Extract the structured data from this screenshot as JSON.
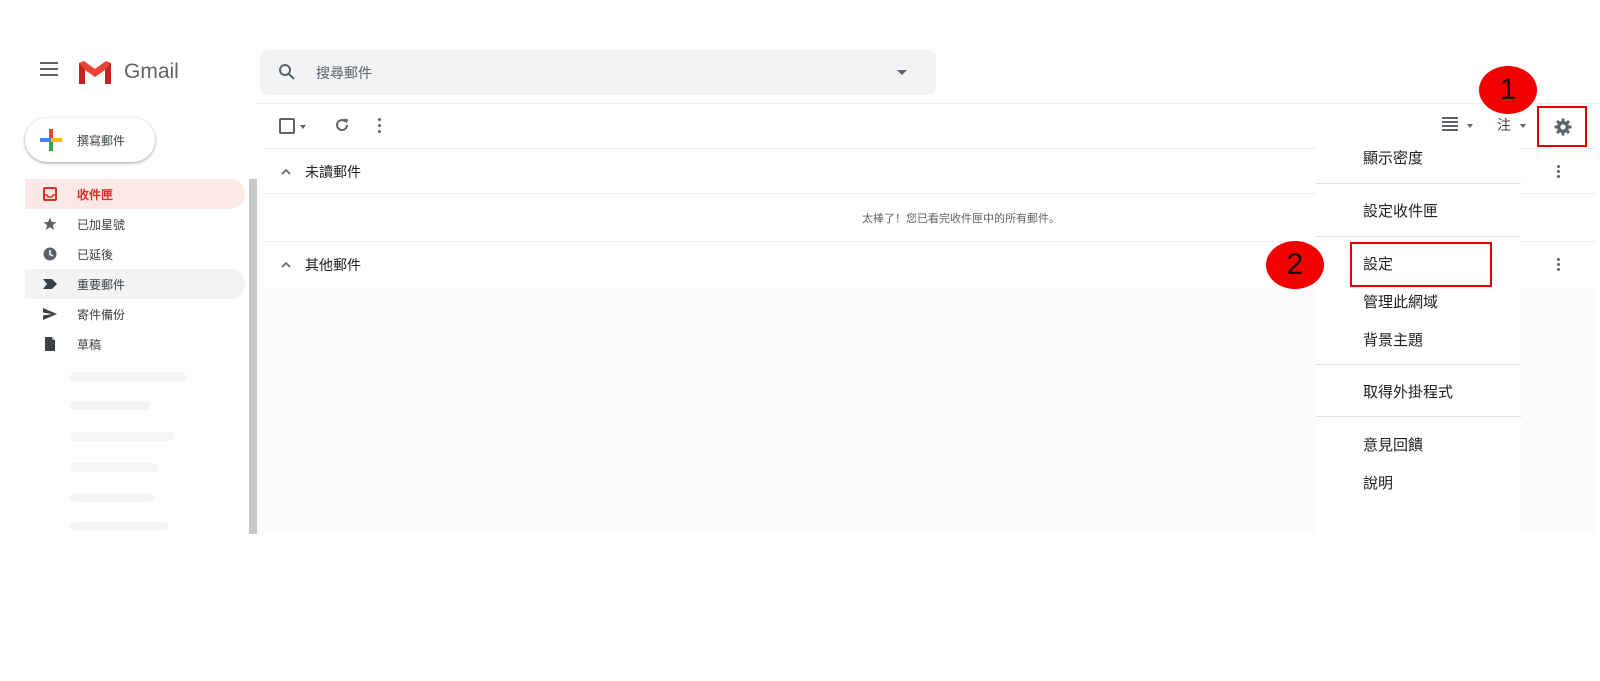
{
  "header": {
    "brand": "Gmail",
    "search": {
      "placeholder": "搜尋郵件"
    }
  },
  "sidebar": {
    "compose_label": "撰寫郵件",
    "items": [
      {
        "label": "收件匣",
        "icon": "inbox-icon",
        "state": "active"
      },
      {
        "label": "已加星號",
        "icon": "star-icon"
      },
      {
        "label": "已延後",
        "icon": "clock-icon"
      },
      {
        "label": "重要郵件",
        "icon": "important-label-icon",
        "state": "shaded"
      },
      {
        "label": "寄件備份",
        "icon": "send-icon"
      },
      {
        "label": "草稿",
        "icon": "draft-icon"
      }
    ]
  },
  "main": {
    "sections": [
      {
        "title": "未讀郵件",
        "empty_message": "太棒了！您已看完收件匣中的所有郵件。"
      },
      {
        "title": "其他郵件"
      }
    ]
  },
  "toolbar_right": {
    "input_tool_label": "注"
  },
  "settings_menu": {
    "items": [
      "顯示密度",
      "設定收件匣",
      "設定",
      "管理此網域",
      "背景主題",
      "取得外掛程式",
      "意見回饋",
      "說明"
    ]
  },
  "annotations": {
    "badge_1": "1",
    "badge_2": "2",
    "badge_color": "#f20000",
    "box_color": "#e00000"
  },
  "colors": {
    "active_nav_bg": "#fce8e6",
    "active_nav_text": "#d93025",
    "gmail_red": "#ea4335"
  }
}
